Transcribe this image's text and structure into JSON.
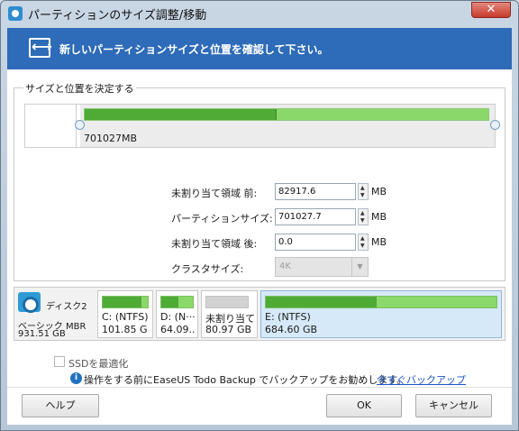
{
  "window": {
    "title": "パーティションのサイズ調整/移動",
    "close_label": "✕"
  },
  "header": {
    "text": "新しいパーティションサイズと位置を確認して下さい。"
  },
  "group": {
    "legend": "サイズと位置を決定する",
    "partition_size_label": "701027MB",
    "usage_fraction": 0.475
  },
  "form": {
    "before_label": "未割り当て領域 前:",
    "before_value": "82917.6",
    "size_label": "パーティションサイズ:",
    "size_value": "701027.7",
    "after_label": "未割り当て領域 後:",
    "after_value": "0.0",
    "cluster_label": "クラスタサイズ:",
    "cluster_value": "4K",
    "unit": "MB"
  },
  "disk": {
    "name": "ディスク2",
    "type": "ベーシック MBR",
    "size": "931.51 GB",
    "partitions": [
      {
        "label": "C: (NTFS)",
        "size": "101.85 G",
        "usage": 0.85,
        "style": "green"
      },
      {
        "label": "D: (N···",
        "size": "64.09..",
        "usage": 0.55,
        "style": "green"
      },
      {
        "label": "未割り当て",
        "size": "80.97 GB",
        "usage": 0,
        "style": "gray"
      },
      {
        "label": "E: (NTFS)",
        "size": "684.60 GB",
        "usage": 0.48,
        "style": "green"
      }
    ]
  },
  "options": {
    "ssd_label": "SSDを最適化",
    "info_text": "操作をする前にEaseUS Todo Backup でバックアップをお勧めします。",
    "info_link": "今すぐバックアップ"
  },
  "buttons": {
    "help": "ヘルプ",
    "ok": "OK",
    "cancel": "キャンセル"
  }
}
